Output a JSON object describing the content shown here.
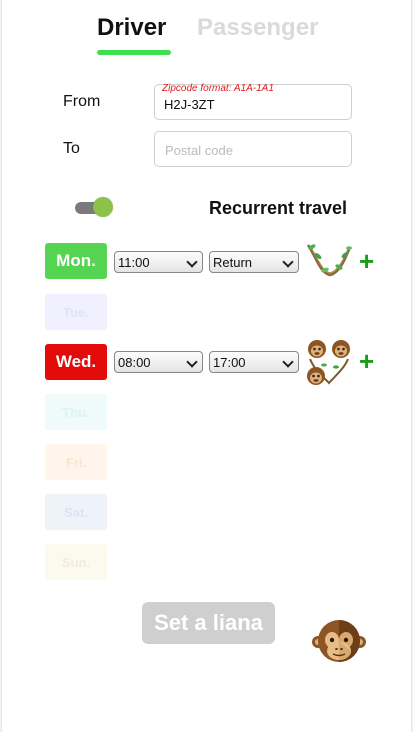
{
  "tabs": {
    "driver": "Driver",
    "passenger": "Passenger"
  },
  "form": {
    "from_label": "From",
    "from_hint": "Zipcode format: A1A-1A1",
    "from_value": "H2J-3ZT",
    "to_label": "To",
    "to_placeholder": "Postal code"
  },
  "recurrent": {
    "label": "Recurrent travel",
    "enabled": true
  },
  "days": [
    {
      "label": "Mon.",
      "active": true,
      "color": "#55d452",
      "depart": "11:00",
      "return": "Return"
    },
    {
      "label": "Tue.",
      "active": false,
      "color": "#f1f0fe"
    },
    {
      "label": "Wed.",
      "active": true,
      "color": "#e30a0a",
      "depart": "08:00",
      "return": "17:00"
    },
    {
      "label": "Thu.",
      "active": false,
      "color": "#effafa"
    },
    {
      "label": "Fri.",
      "active": false,
      "color": "#fff5eb"
    },
    {
      "label": "Sat.",
      "active": false,
      "color": "#eef3fa"
    },
    {
      "label": "Sun.",
      "active": false,
      "color": "#fcf9ef"
    }
  ],
  "actions": {
    "plus": "+",
    "set_button": "Set a liana"
  },
  "icons": {
    "liana": "liana-icon",
    "monkeys": "monkeys-icon",
    "avatar": "monkey-face-icon",
    "toggle": "toggle-switch"
  },
  "colors": {
    "accent_green": "#3ee04e",
    "plus_green": "#169e16",
    "hint_red": "#e01b1b"
  }
}
